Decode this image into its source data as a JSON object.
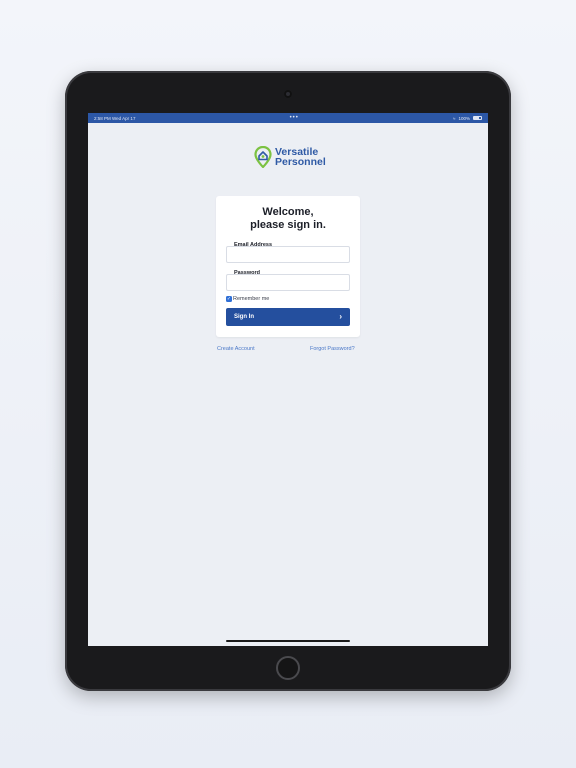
{
  "status_bar": {
    "left_text": "2:58 PM  Wed Apr 17",
    "center_text": "•••",
    "right_text": "100%"
  },
  "logo": {
    "line1": "Versatile",
    "line2": "Personnel",
    "icon": "location-pin-leaf-icon",
    "colors": {
      "primary": "#2f5aa5",
      "accent": "#7cc242"
    }
  },
  "sign_in_card": {
    "heading_line1": "Welcome,",
    "heading_line2": "please sign in.",
    "email_label": "Email Address",
    "email_value": "",
    "password_label": "Password",
    "password_value": "",
    "remember_label": "Remember me",
    "remember_checked": true,
    "submit_label": "Sign In",
    "submit_icon": "chevron-right-icon"
  },
  "links": {
    "create_account": "Create Account",
    "forgot_password": "Forgot Password?"
  },
  "theme": {
    "brand_blue": "#244f9e",
    "link_blue": "#4a78c8",
    "background": "#eceff4"
  }
}
